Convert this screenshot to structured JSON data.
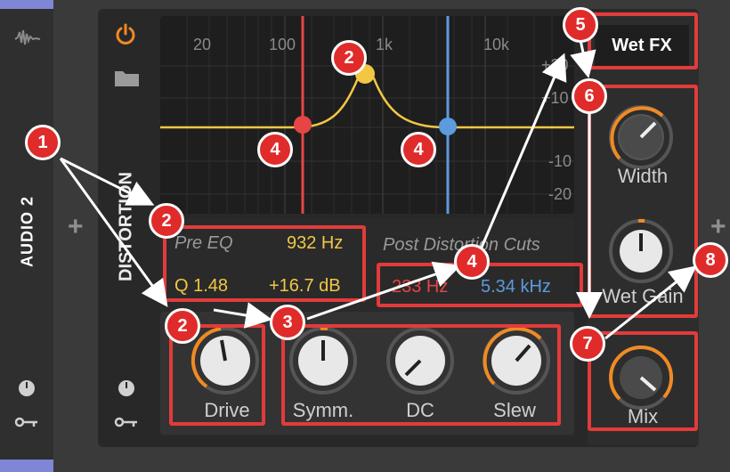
{
  "track": {
    "name": "AUDIO 2"
  },
  "device": {
    "title": "DISTORTION"
  },
  "graph": {
    "freq_labels": [
      "20",
      "100",
      "1k",
      "10k"
    ],
    "db_labels": [
      "+20",
      "+10",
      "-10",
      "-20"
    ]
  },
  "pre_eq": {
    "label": "Pre EQ",
    "freq": "932 Hz",
    "q": "Q 1.48",
    "gain": "+16.7 dB"
  },
  "post_cuts": {
    "label": "Post Distortion Cuts",
    "low": "233 Hz",
    "high": "5.34 kHz"
  },
  "knobs": {
    "drive": "Drive",
    "symm": "Symm.",
    "dc": "DC",
    "slew": "Slew",
    "width": "Width",
    "wet_gain": "Wet Gain",
    "mix": "Mix"
  },
  "wet_fx": {
    "label": "Wet FX"
  },
  "badges": [
    "1",
    "2",
    "2",
    "3",
    "4",
    "4",
    "4",
    "5",
    "6",
    "7",
    "8"
  ],
  "colors": {
    "accent_orange": "#f08a24",
    "eq_yellow": "#f2c744",
    "cut_red": "#e64545",
    "cut_blue": "#5b9bde",
    "callout_red": "#e02b2b"
  }
}
